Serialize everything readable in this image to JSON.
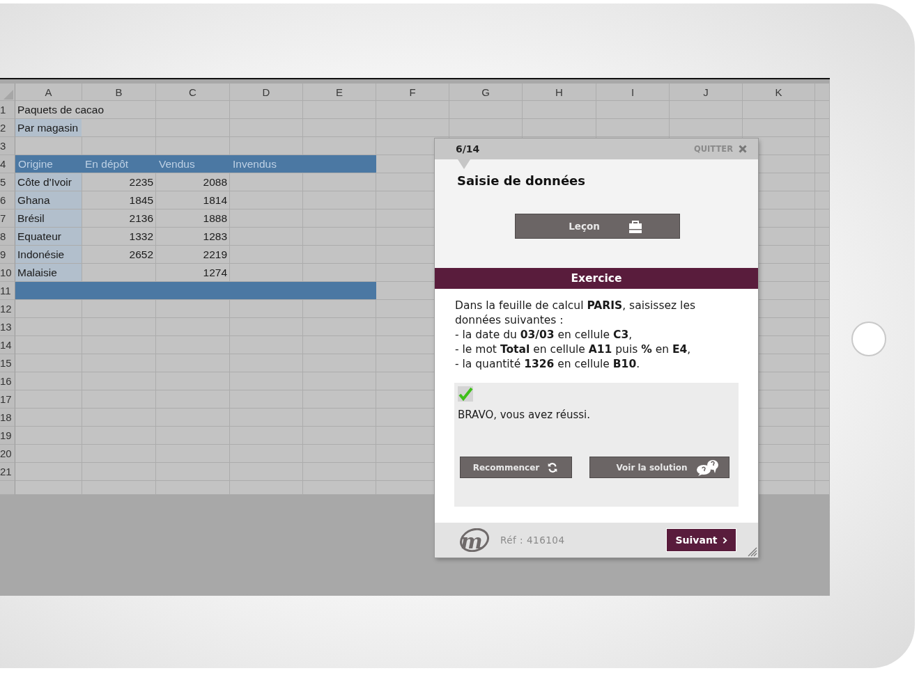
{
  "sheet": {
    "columns": [
      "A",
      "B",
      "C",
      "D",
      "E",
      "F",
      "G",
      "H",
      "I",
      "J",
      "K"
    ],
    "rows": [
      {
        "number": "1",
        "band": false,
        "first_selected": false,
        "cells": [
          "Paquets de cacao"
        ]
      },
      {
        "number": "2",
        "band": false,
        "first_selected": true,
        "cells": [
          "Par magasin"
        ]
      },
      {
        "number": "3",
        "band": false,
        "first_selected": false
      },
      {
        "number": "4",
        "band": true,
        "cells": [
          "Origine",
          "En dépôt",
          "Vendus",
          "Invendus"
        ]
      },
      {
        "number": "5",
        "band": false,
        "first_selected": true,
        "cells": [
          "Côte d'Ivoir",
          "2235",
          "2088"
        ]
      },
      {
        "number": "6",
        "band": false,
        "first_selected": true,
        "cells": [
          "Ghana",
          "1845",
          "1814"
        ]
      },
      {
        "number": "7",
        "band": false,
        "first_selected": true,
        "cells": [
          "Brésil",
          "2136",
          "1888"
        ]
      },
      {
        "number": "8",
        "band": false,
        "first_selected": true,
        "cells": [
          "Equateur",
          "1332",
          "1283"
        ]
      },
      {
        "number": "9",
        "band": false,
        "first_selected": true,
        "cells": [
          "Indonésie",
          "2652",
          "2219"
        ]
      },
      {
        "number": "10",
        "band": false,
        "first_selected": true,
        "cells": [
          "Malaisie",
          null,
          "1274"
        ]
      },
      {
        "number": "11",
        "band": true
      },
      {
        "number": "12",
        "band": false,
        "first_selected": false
      },
      {
        "number": "13",
        "band": false,
        "first_selected": false
      },
      {
        "number": "14",
        "band": false,
        "first_selected": false
      },
      {
        "number": "15",
        "band": false,
        "first_selected": false
      },
      {
        "number": "16",
        "band": false,
        "first_selected": false
      },
      {
        "number": "17",
        "band": false,
        "first_selected": false
      },
      {
        "number": "18",
        "band": false,
        "first_selected": false
      },
      {
        "number": "19",
        "band": false,
        "first_selected": false
      },
      {
        "number": "20",
        "band": false,
        "first_selected": false
      },
      {
        "number": "21",
        "band": false,
        "first_selected": false
      }
    ]
  },
  "dialog": {
    "step": "6/14",
    "quit": "QUITTER",
    "title": "Saisie de données",
    "lesson_button": "Leçon",
    "section": "Exercice",
    "instructions": {
      "intro": "Dans la feuille de calcul **PARIS**, saisissez les données suivantes :",
      "items": [
        "- la date du **03/03** en cellule **C3**,",
        "- le mot **Total** en cellule **A11** puis **%** en **E4**,",
        "- la quantité **1326** en cellule **B10**."
      ]
    },
    "feedback": {
      "success": true,
      "message": "BRAVO, vous avez réussi."
    },
    "buttons": [
      {
        "kind": "restart",
        "label": "Recommencer"
      },
      {
        "kind": "solution",
        "label": "Voir la solution"
      }
    ],
    "footer": {
      "logo": "m",
      "reference": "Réf : 416104",
      "next": "Suivant"
    }
  }
}
